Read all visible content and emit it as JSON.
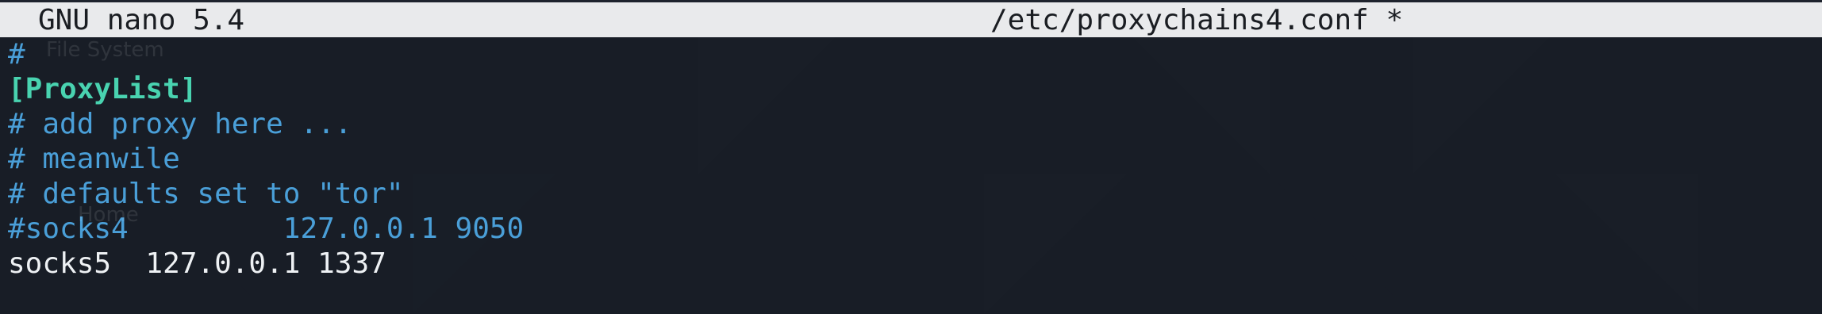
{
  "titlebar": {
    "app_version": "GNU nano 5.4",
    "filename": "/etc/proxychains4.conf *"
  },
  "editor": {
    "lines": [
      "#",
      "[ProxyList]",
      "# add proxy here ...",
      "# meanwile",
      "# defaults set to \"tor\"",
      "#socks4         127.0.0.1 9050",
      "socks5  127.0.0.1 1337"
    ]
  },
  "background": {
    "ghost_labels": [
      "File System",
      "Home"
    ]
  },
  "colors": {
    "titlebar_bg": "#e9eaec",
    "comment": "#4a9fd8",
    "section_header": "#49d3b0",
    "plain_text": "#eef1f4",
    "editor_bg": "#1b2029"
  }
}
